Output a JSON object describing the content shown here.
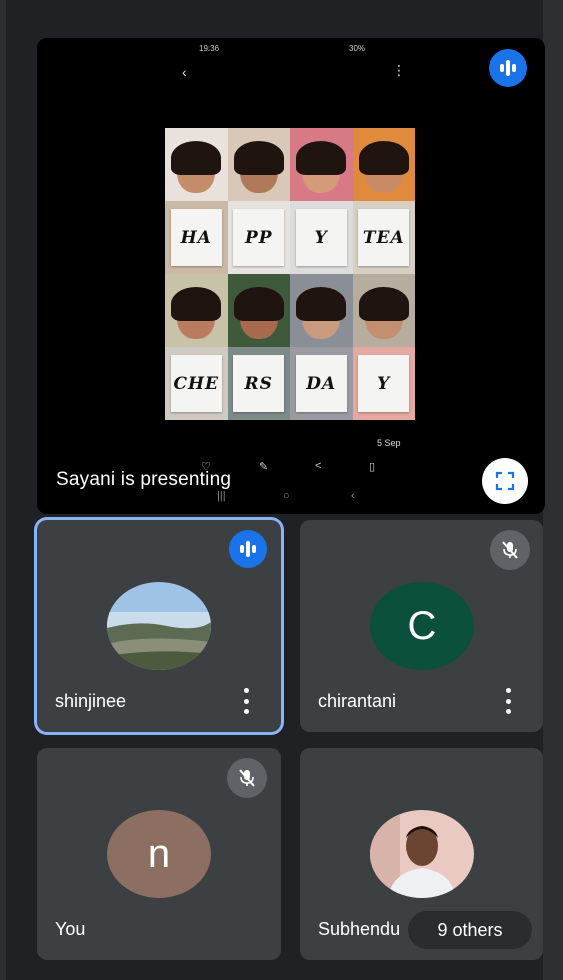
{
  "presentation": {
    "presenting_label": "Sayani is presenting",
    "status_time": "19:36",
    "status_right": "30% ",
    "date_stamp": "5 Sep",
    "collage_cards": [
      "HA",
      "PP",
      "Y",
      "TEA",
      "CHE",
      "RS",
      "DA",
      "Y"
    ]
  },
  "participants": [
    {
      "name": "shinjinee",
      "avatar_type": "photo",
      "state": "speaking"
    },
    {
      "name": "chirantani",
      "initial": "C",
      "avatar_color": "#0b4f3d",
      "state": "muted"
    },
    {
      "name": "You",
      "initial": "n",
      "avatar_color": "#8d6e63",
      "state": "muted"
    },
    {
      "name": "Subhendu",
      "avatar_type": "photo",
      "state": "normal"
    }
  ],
  "others": {
    "label": "9 others"
  },
  "colors": {
    "background": "#202124",
    "tile": "#3c4043",
    "accent": "#1a73e8",
    "active_border": "#8ab4f8"
  },
  "icons": {
    "audio": "audio-level-icon",
    "mic_off": "mic-off-icon",
    "fullscreen": "fullscreen-icon",
    "more": "more-vert-icon"
  }
}
